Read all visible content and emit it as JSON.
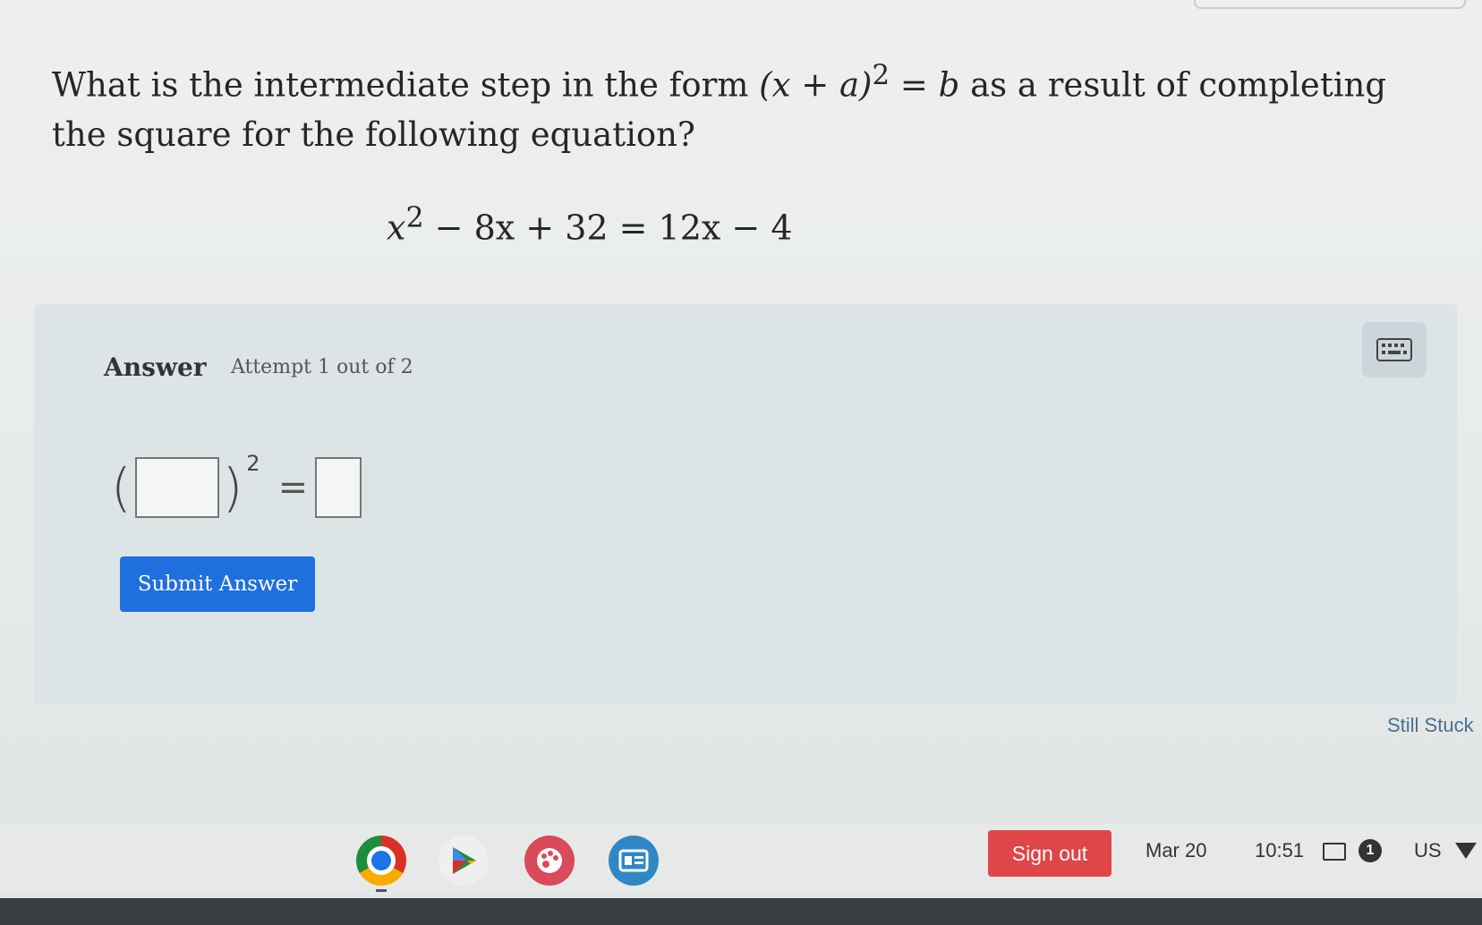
{
  "question": {
    "text_before": "What is the intermediate step in the form ",
    "form": "(x + a)",
    "form_exp": "2",
    "form_rhs": " = b",
    "text_after": " as a result of completing the square for the following equation?"
  },
  "equation": {
    "lhs": "x",
    "lhs_exp": "2",
    "rest": " − 8x + 32 = 12x − 4"
  },
  "answer": {
    "title": "Answer",
    "attempt": "Attempt 1 out of 2",
    "open_paren": "(",
    "close_paren": ")",
    "exponent": "2",
    "equals": "=",
    "input_a": "",
    "input_b": "",
    "submit_label": "Submit Answer"
  },
  "help": {
    "still_stuck": "Still Stuck"
  },
  "shelf": {
    "apps": [
      "chrome-icon",
      "play-store-icon",
      "palette-icon",
      "classroom-icon"
    ],
    "sign_out_label": "Sign out",
    "date": "Mar 20",
    "time": "10:51",
    "notification_count": "1",
    "language": "US"
  },
  "colors": {
    "submit_button": "#1f6fde",
    "sign_out_button": "#e0454a",
    "panel": "#dde4e6"
  }
}
